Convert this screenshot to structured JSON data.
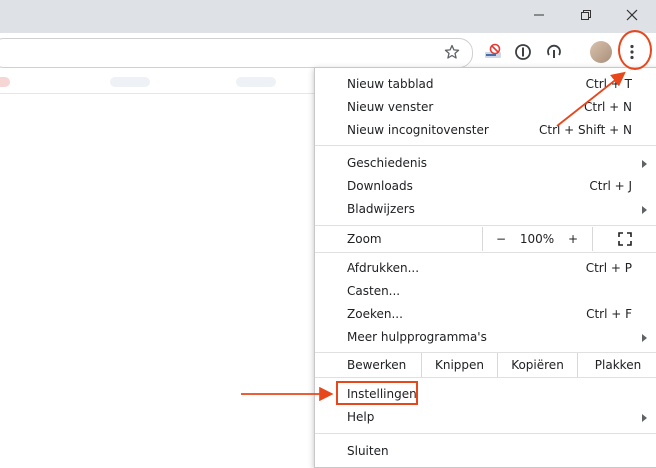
{
  "window": {
    "minimize_icon": "minimize-icon",
    "restore_icon": "restore-icon",
    "close_icon": "close-icon"
  },
  "toolbar": {
    "star_icon": "star-icon",
    "extension_icons": [
      "notification-extension-icon",
      "password-manager-icon",
      "update-icon"
    ],
    "avatar": "profile-avatar",
    "menu_icon": "kebab-menu-icon"
  },
  "menu": {
    "group1": [
      {
        "label": "Nieuw tabblad",
        "shortcut": "Ctrl + T"
      },
      {
        "label": "Nieuw venster",
        "shortcut": "Ctrl + N"
      },
      {
        "label": "Nieuw incognitovenster",
        "shortcut": "Ctrl + Shift + N"
      }
    ],
    "group2": [
      {
        "label": "Geschiedenis",
        "shortcut": ""
      },
      {
        "label": "Downloads",
        "shortcut": "Ctrl + J"
      },
      {
        "label": "Bladwijzers",
        "shortcut": ""
      }
    ],
    "zoom": {
      "label": "Zoom",
      "minus": "−",
      "value": "100%",
      "plus": "+",
      "fullscreen_icon": "fullscreen-icon"
    },
    "group3": [
      {
        "label": "Afdrukken...",
        "shortcut": "Ctrl + P"
      },
      {
        "label": "Casten...",
        "shortcut": ""
      },
      {
        "label": "Zoeken...",
        "shortcut": "Ctrl + F"
      },
      {
        "label": "Meer hulpprogramma's",
        "shortcut": ""
      }
    ],
    "edit": {
      "label": "Bewerken",
      "cut": "Knippen",
      "copy": "Kopiëren",
      "paste": "Plakken"
    },
    "group4": [
      {
        "label": "Instellingen"
      },
      {
        "label": "Help"
      }
    ],
    "exit": {
      "label": "Sluiten"
    }
  },
  "annotations": {
    "color": "#e8471c"
  }
}
